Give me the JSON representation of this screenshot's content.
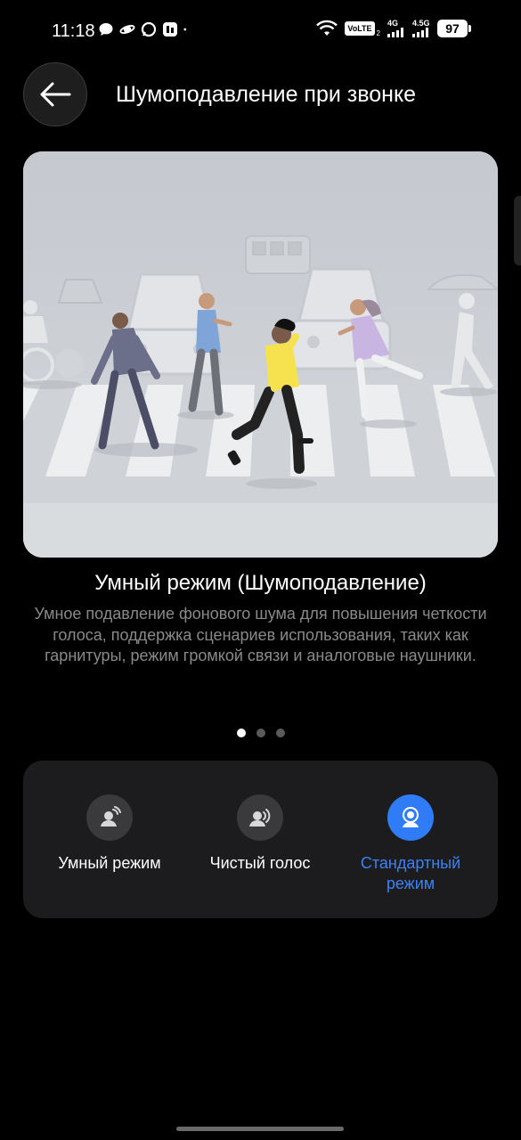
{
  "status_bar": {
    "time": "11:18",
    "volte": "VoLTE",
    "volte_sim": "2",
    "net1": "4G",
    "net2": "4.5G",
    "battery": "97"
  },
  "header": {
    "title": "Шумоподавление при звонке"
  },
  "content": {
    "mode_title": "Умный режим (Шумоподавление)",
    "mode_description": "Умное подавление фонового шума для повышения четкости голоса, поддержка сценариев использования, таких как гарнитуры, режим громкой связи и аналоговые наушники."
  },
  "pager": {
    "count": 3,
    "active_index": 0
  },
  "modes": [
    {
      "label": "Умный режим",
      "icon": "smart-voice-icon",
      "selected": false
    },
    {
      "label": "Чистый голос",
      "icon": "clear-voice-icon",
      "selected": false
    },
    {
      "label": "Стандартный режим",
      "icon": "standard-mode-icon",
      "selected": true
    }
  ],
  "colors": {
    "background": "#000000",
    "panel": "#1c1c1e",
    "accent": "#2f7cf6",
    "description_text": "#8a8a8a"
  }
}
